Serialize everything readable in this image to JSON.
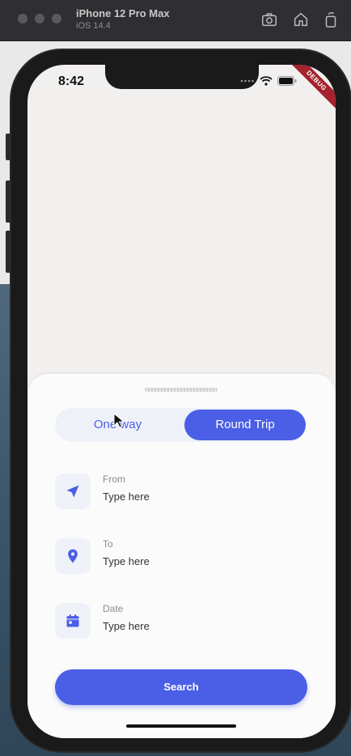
{
  "simulator": {
    "device_name": "iPhone 12 Pro Max",
    "os_version": "iOS 14.4",
    "tools": [
      "camera-icon",
      "home-icon",
      "rotate-icon"
    ]
  },
  "status_bar": {
    "time": "8:42",
    "debug_label": "DEBUG"
  },
  "trip_toggle": {
    "one_way_label": "One way",
    "round_trip_label": "Round Trip",
    "selected": "Round Trip"
  },
  "fields": {
    "from": {
      "label": "From",
      "placeholder": "Type here",
      "icon": "navigation-arrow-icon"
    },
    "to": {
      "label": "To",
      "placeholder": "Type here",
      "icon": "location-pin-icon"
    },
    "date": {
      "label": "Date",
      "placeholder": "Type here",
      "icon": "calendar-icon"
    }
  },
  "search_button_label": "Search",
  "colors": {
    "accent": "#4a5ee6",
    "icon_bg": "#eef1f8",
    "screen_bg": "#f2f0ef",
    "sheet_bg": "#fbfbfb",
    "debug_ribbon": "#a4232f"
  }
}
